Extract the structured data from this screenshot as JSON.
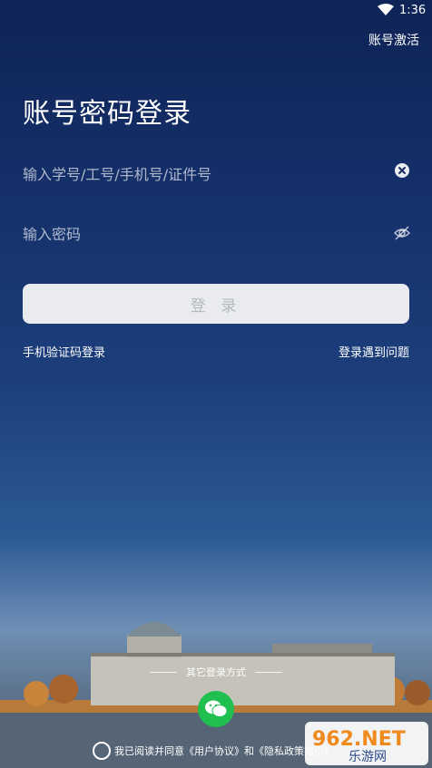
{
  "status_bar": {
    "time": "1:36"
  },
  "header": {
    "activate_label": "账号激活"
  },
  "login": {
    "title": "账号密码登录",
    "account_placeholder": "输入学号/工号/手机号/证件号",
    "password_placeholder": "输入密码",
    "login_button": "登 录",
    "sms_login": "手机验证码登录",
    "problem": "登录遇到问题"
  },
  "footer": {
    "other_methods": "其它登录方式",
    "agree_prefix": "我已阅读并同意",
    "user_agreement": "《用户协议》",
    "and": "和",
    "privacy_policy": "《隐私政策指引》"
  },
  "watermark": {
    "line1": "962.NET",
    "line2": "乐游网"
  },
  "colors": {
    "accent": "#1fbf50",
    "bg_top": "#0f2456",
    "bg_bottom": "#3d4b5a"
  },
  "icons": {
    "wifi": "wifi-icon",
    "clear": "clear-icon",
    "eye": "eye-off-icon",
    "wechat": "wechat-icon"
  }
}
